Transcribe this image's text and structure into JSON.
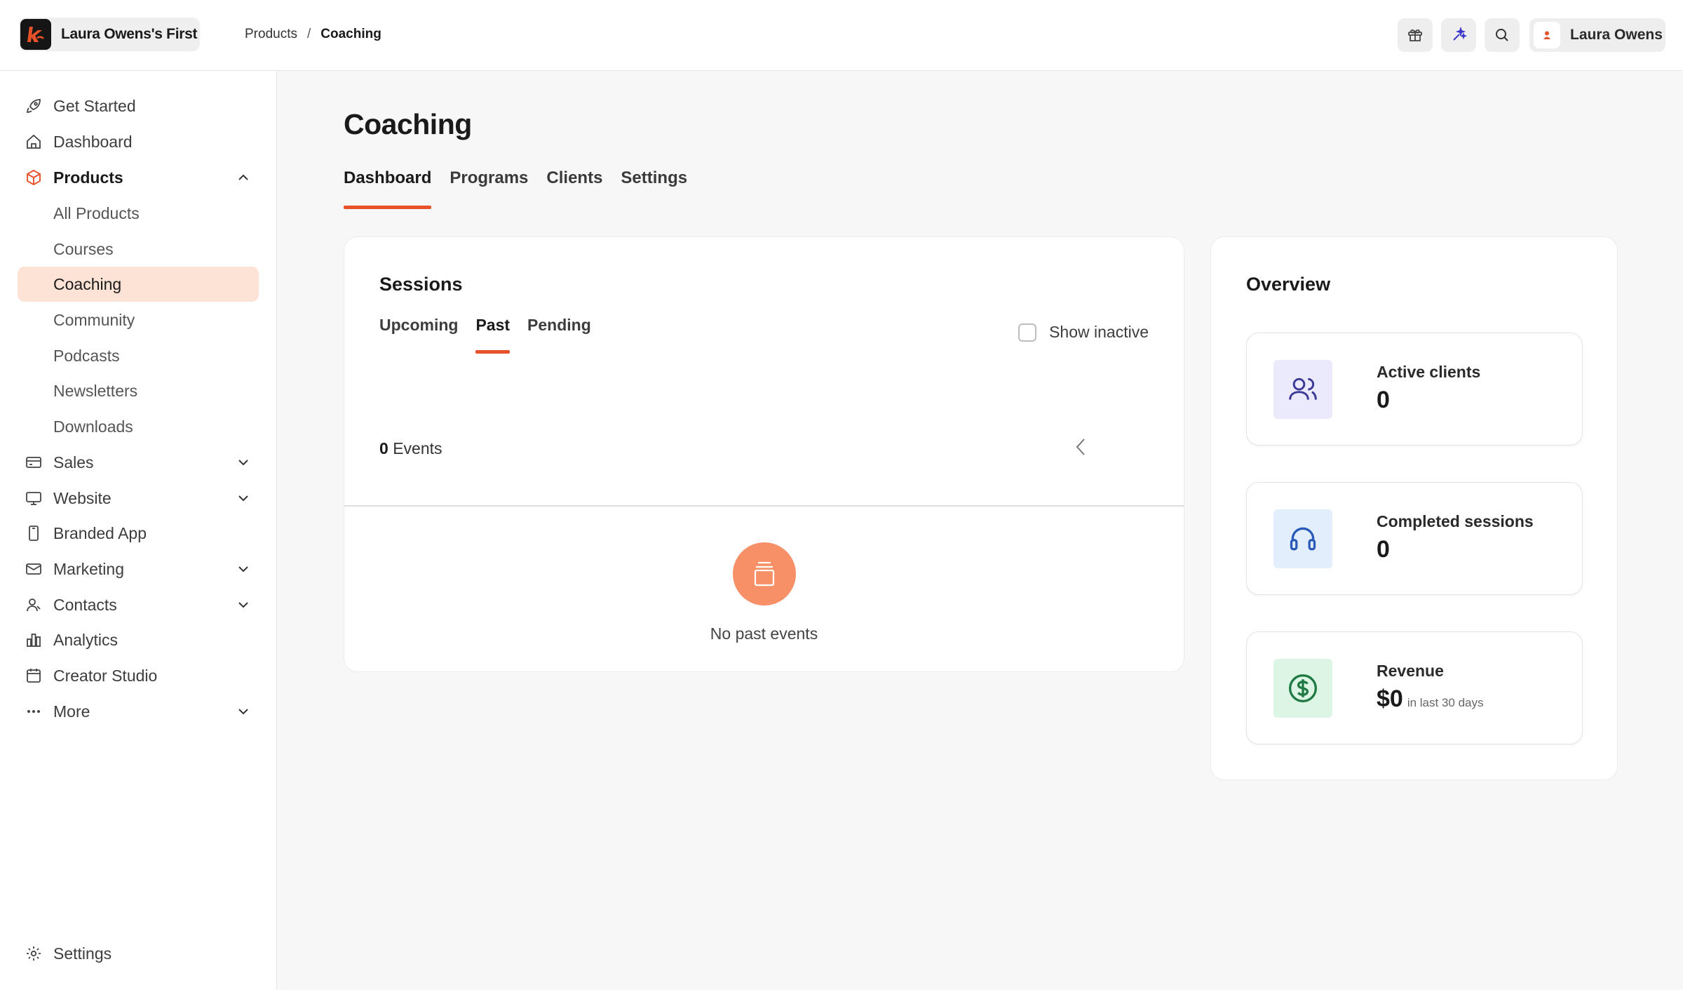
{
  "header": {
    "brand_name": "Laura Owens's First",
    "breadcrumb": [
      "Products",
      "Coaching"
    ],
    "user_name": "Laura Owens",
    "accent": "#e8522b"
  },
  "sidebar": {
    "items": [
      {
        "label": "Get Started",
        "icon": "rocket-icon"
      },
      {
        "label": "Dashboard",
        "icon": "home-icon"
      },
      {
        "label": "Products",
        "icon": "box-icon"
      },
      {
        "label": "Sales",
        "icon": "credit-card-icon"
      },
      {
        "label": "Website",
        "icon": "monitor-icon"
      },
      {
        "label": "Branded App",
        "icon": "phone-icon"
      },
      {
        "label": "Marketing",
        "icon": "mail-icon"
      },
      {
        "label": "Contacts",
        "icon": "user-icon"
      },
      {
        "label": "Analytics",
        "icon": "bar-chart-icon"
      },
      {
        "label": "Creator Studio",
        "icon": "calendar-icon"
      },
      {
        "label": "More",
        "icon": "more-icon"
      }
    ],
    "products_sub": [
      "All Products",
      "Courses",
      "Coaching",
      "Community",
      "Podcasts",
      "Newsletters",
      "Downloads"
    ],
    "settings_label": "Settings"
  },
  "main": {
    "title": "Coaching",
    "tabs": [
      "Dashboard",
      "Programs",
      "Clients",
      "Settings"
    ],
    "sessions": {
      "title": "Sessions",
      "tabs": [
        "Upcoming",
        "Past",
        "Pending"
      ],
      "show_inactive_label": "Show inactive",
      "events_count": "0",
      "events_label": "Events",
      "empty_text": "No past events"
    },
    "overview": {
      "title": "Overview",
      "stats": [
        {
          "label": "Active clients",
          "value": "0",
          "color": "#ebe9fc"
        },
        {
          "label": "Completed sessions",
          "value": "0",
          "color": "#e3eefc"
        },
        {
          "label": "Revenue",
          "value": "$0",
          "sub": "in last 30 days",
          "color": "#dcf5e4"
        }
      ]
    }
  }
}
